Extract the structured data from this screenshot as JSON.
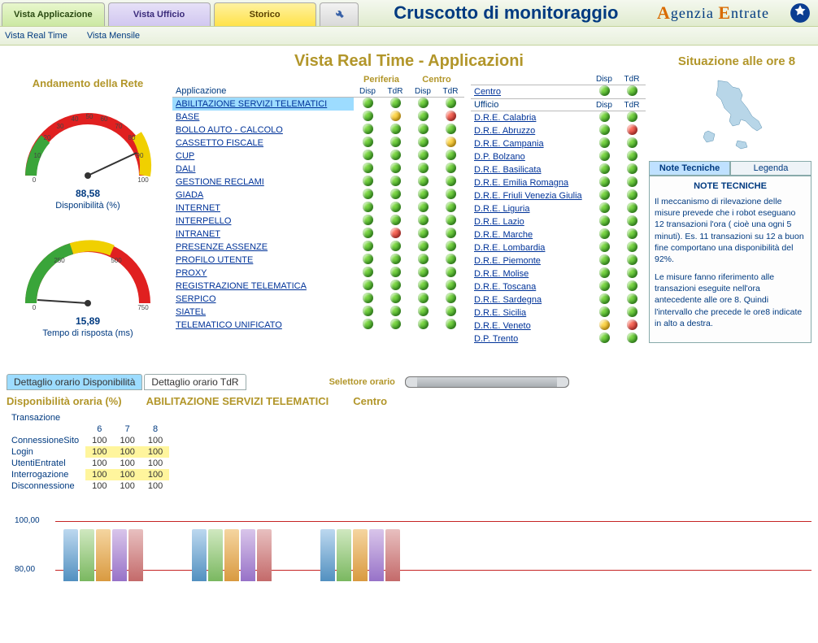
{
  "header": {
    "tabs": [
      "Vista Applicazione",
      "Vista Ufficio",
      "Storico"
    ],
    "title": "Cruscotto di monitoraggio",
    "brand_l1": "genzia",
    "brand_l2": "ntrate",
    "subtabs": [
      "Vista Real Time",
      "Vista Mensile"
    ]
  },
  "heading": "Vista Real Time - Applicazioni",
  "situation": "Situazione alle ore 8",
  "gauges": {
    "title": "Andamento della Rete",
    "avail_value": "88,58",
    "avail_label": "Disponibilità (%)",
    "rt_value": "15,89",
    "rt_label": "Tempo di risposta (ms)"
  },
  "apps": {
    "col_app": "Applicazione",
    "group_per": "Periferia",
    "group_cen": "Centro",
    "col_disp": "Disp",
    "col_tdr": "TdR",
    "rows": [
      {
        "name": "ABILITAZIONE SERVIZI TELEMATICI",
        "pD": "g",
        "pT": "g",
        "cD": "g",
        "cT": "g",
        "sel": true
      },
      {
        "name": "BASE",
        "pD": "g",
        "pT": "y",
        "cD": "g",
        "cT": "r"
      },
      {
        "name": "BOLLO AUTO - CALCOLO",
        "pD": "g",
        "pT": "g",
        "cD": "g",
        "cT": "g"
      },
      {
        "name": "CASSETTO FISCALE",
        "pD": "g",
        "pT": "g",
        "cD": "g",
        "cT": "y"
      },
      {
        "name": "CUP",
        "pD": "g",
        "pT": "g",
        "cD": "g",
        "cT": "g"
      },
      {
        "name": "DALI",
        "pD": "g",
        "pT": "g",
        "cD": "g",
        "cT": "g"
      },
      {
        "name": "GESTIONE RECLAMI",
        "pD": "g",
        "pT": "g",
        "cD": "g",
        "cT": "g"
      },
      {
        "name": "GIADA",
        "pD": "g",
        "pT": "g",
        "cD": "g",
        "cT": "g"
      },
      {
        "name": "INTERNET",
        "pD": "g",
        "pT": "g",
        "cD": "g",
        "cT": "g"
      },
      {
        "name": "INTERPELLO",
        "pD": "g",
        "pT": "g",
        "cD": "g",
        "cT": "g"
      },
      {
        "name": "INTRANET",
        "pD": "g",
        "pT": "r",
        "cD": "g",
        "cT": "g"
      },
      {
        "name": "PRESENZE ASSENZE",
        "pD": "g",
        "pT": "g",
        "cD": "g",
        "cT": "g"
      },
      {
        "name": "PROFILO UTENTE",
        "pD": "g",
        "pT": "g",
        "cD": "g",
        "cT": "g"
      },
      {
        "name": "PROXY",
        "pD": "g",
        "pT": "g",
        "cD": "g",
        "cT": "g"
      },
      {
        "name": "REGISTRAZIONE TELEMATICA",
        "pD": "g",
        "pT": "g",
        "cD": "g",
        "cT": "g"
      },
      {
        "name": "SERPICO",
        "pD": "g",
        "pT": "g",
        "cD": "g",
        "cT": "g"
      },
      {
        "name": "SIATEL",
        "pD": "g",
        "pT": "g",
        "cD": "g",
        "cT": "g"
      },
      {
        "name": "TELEMATICO UNIFICATO",
        "pD": "g",
        "pT": "g",
        "cD": "g",
        "cT": "g"
      }
    ]
  },
  "offices": {
    "col_disp": "Disp",
    "col_tdr": "TdR",
    "centro_label": "Centro",
    "centro_D": "g",
    "centro_T": "g",
    "ufficio_label": "Ufficio",
    "rows": [
      {
        "name": "D.R.E. Calabria",
        "D": "g",
        "T": "g"
      },
      {
        "name": "D.R.E. Abruzzo",
        "D": "g",
        "T": "r"
      },
      {
        "name": "D.R.E. Campania",
        "D": "g",
        "T": "g"
      },
      {
        "name": "D.P. Bolzano",
        "D": "g",
        "T": "g"
      },
      {
        "name": "D.R.E. Basilicata",
        "D": "g",
        "T": "g"
      },
      {
        "name": "D.R.E. Emilia Romagna",
        "D": "g",
        "T": "g"
      },
      {
        "name": "D.R.E. Friuli Venezia Giulia",
        "D": "g",
        "T": "g"
      },
      {
        "name": "D.R.E. Liguria",
        "D": "g",
        "T": "g"
      },
      {
        "name": "D.R.E. Lazio",
        "D": "g",
        "T": "g"
      },
      {
        "name": "D.R.E. Marche",
        "D": "g",
        "T": "g"
      },
      {
        "name": "D.R.E. Lombardia",
        "D": "g",
        "T": "g"
      },
      {
        "name": "D.R.E. Piemonte",
        "D": "g",
        "T": "g"
      },
      {
        "name": "D.R.E. Molise",
        "D": "g",
        "T": "g"
      },
      {
        "name": "D.R.E. Toscana",
        "D": "g",
        "T": "g"
      },
      {
        "name": "D.R.E. Sardegna",
        "D": "g",
        "T": "g"
      },
      {
        "name": "D.R.E. Sicilia",
        "D": "g",
        "T": "g"
      },
      {
        "name": "D.R.E. Veneto",
        "D": "y",
        "T": "r"
      },
      {
        "name": "D.P. Trento",
        "D": "g",
        "T": "g"
      }
    ]
  },
  "side": {
    "tab_note": "Note Tecniche",
    "tab_leg": "Legenda",
    "note_title": "NOTE TECNICHE",
    "note_p1": "Il meccanismo di rilevazione delle misure prevede che i robot eseguano 12 transazioni l'ora ( cioè una ogni 5 minuti). Es. 11 transazioni su 12 a buon fine comportano una disponibilità del 92%.",
    "note_p2": "Le misure fanno riferimento alle transazioni eseguite nell'ora antecedente alle ore 8. Quindi l'intervallo che precede le ore8 indicate in alto a destra."
  },
  "lower": {
    "tab1": "Dettaglio orario Disponibilità",
    "tab2": "Dettaglio orario TdR",
    "selettore": "Selettore orario",
    "head1": "Disponibilità oraria (%)",
    "head2": "ABILITAZIONE SERVIZI TELEMATICI",
    "head3": "Centro",
    "trans_label": "Transazione",
    "hours": [
      "6",
      "7",
      "8"
    ],
    "rows": [
      {
        "name": "ConnessioneSito",
        "v": [
          "100",
          "100",
          "100"
        ],
        "hl": false
      },
      {
        "name": "Login",
        "v": [
          "100",
          "100",
          "100"
        ],
        "hl": true
      },
      {
        "name": "UtentiEntratel",
        "v": [
          "100",
          "100",
          "100"
        ],
        "hl": false
      },
      {
        "name": "Interrogazione",
        "v": [
          "100",
          "100",
          "100"
        ],
        "hl": true
      },
      {
        "name": "Disconnessione",
        "v": [
          "100",
          "100",
          "100"
        ],
        "hl": false
      }
    ]
  },
  "chart_data": {
    "type": "bar",
    "title": "Disponibilità oraria (%)",
    "ylabel": "",
    "xlabel": "",
    "ylim": [
      80,
      100
    ],
    "yticks": [
      80,
      100
    ],
    "categories": [
      "6",
      "7",
      "8"
    ],
    "series": [
      {
        "name": "ConnessioneSito",
        "values": [
          100,
          100,
          100
        ]
      },
      {
        "name": "Login",
        "values": [
          100,
          100,
          100
        ]
      },
      {
        "name": "UtentiEntratel",
        "values": [
          100,
          100,
          100
        ]
      },
      {
        "name": "Interrogazione",
        "values": [
          100,
          100,
          100
        ]
      },
      {
        "name": "Disconnessione",
        "values": [
          100,
          100,
          100
        ]
      }
    ]
  }
}
